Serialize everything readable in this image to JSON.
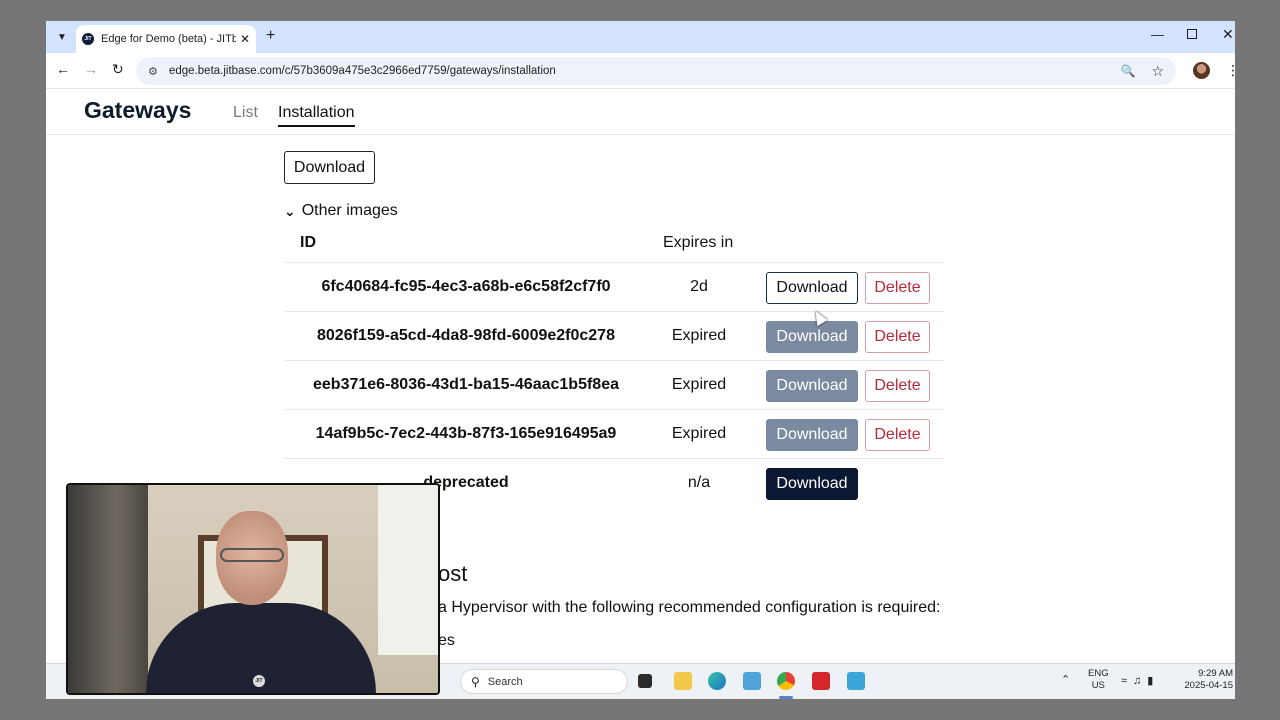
{
  "browser": {
    "tab_title": "Edge for Demo (beta) - JITbase",
    "tab_favicon": "JIT",
    "url": "edge.beta.jitbase.com/c/57b3609a475e3c2966ed7759/gateways/installation"
  },
  "header": {
    "title": "Gateways",
    "tabs": [
      {
        "label": "List",
        "active": false
      },
      {
        "label": "Installation",
        "active": true
      }
    ]
  },
  "main": {
    "download_label": "Download",
    "other_images_label": "Other images",
    "table": {
      "columns": [
        "ID",
        "Expires in"
      ],
      "rows": [
        {
          "id": "6fc40684-fc95-4ec3-a68b-e6c58f2cf7f0",
          "expires": "2d",
          "download": "Download",
          "delete": "Delete",
          "state": "active"
        },
        {
          "id": "8026f159-a5cd-4da8-98fd-6009e2f0c278",
          "expires": "Expired",
          "download": "Download",
          "delete": "Delete",
          "state": "expired"
        },
        {
          "id": "eeb371e6-8036-43d1-ba15-46aac1b5f8ea",
          "expires": "Expired",
          "download": "Download",
          "delete": "Delete",
          "state": "expired"
        },
        {
          "id": "14af9b5c-7ec2-443b-87f3-165e916495a9",
          "expires": "Expired",
          "download": "Download",
          "delete": "Delete",
          "state": "expired"
        },
        {
          "id": "deprecated",
          "expires": "n/a",
          "download": "Download",
          "state": "deprecated"
        }
      ]
    },
    "host_heading_partial": "ost",
    "host_text_partial": "a Hypervisor with the following recommended configuration is required:",
    "host_list_partial": "es"
  },
  "taskbar": {
    "search_label": "Search",
    "lang_line1": "ENG",
    "lang_line2": "US",
    "time": "9:29 AM",
    "date": "2025-04-15"
  },
  "webcam": {
    "shirt_logo": "JIT"
  },
  "colors": {
    "tabstrip": "#d3e3fd",
    "expired_button": "#7a8aa0",
    "dark_button": "#0c1833",
    "delete_text": "#b52a3e"
  }
}
